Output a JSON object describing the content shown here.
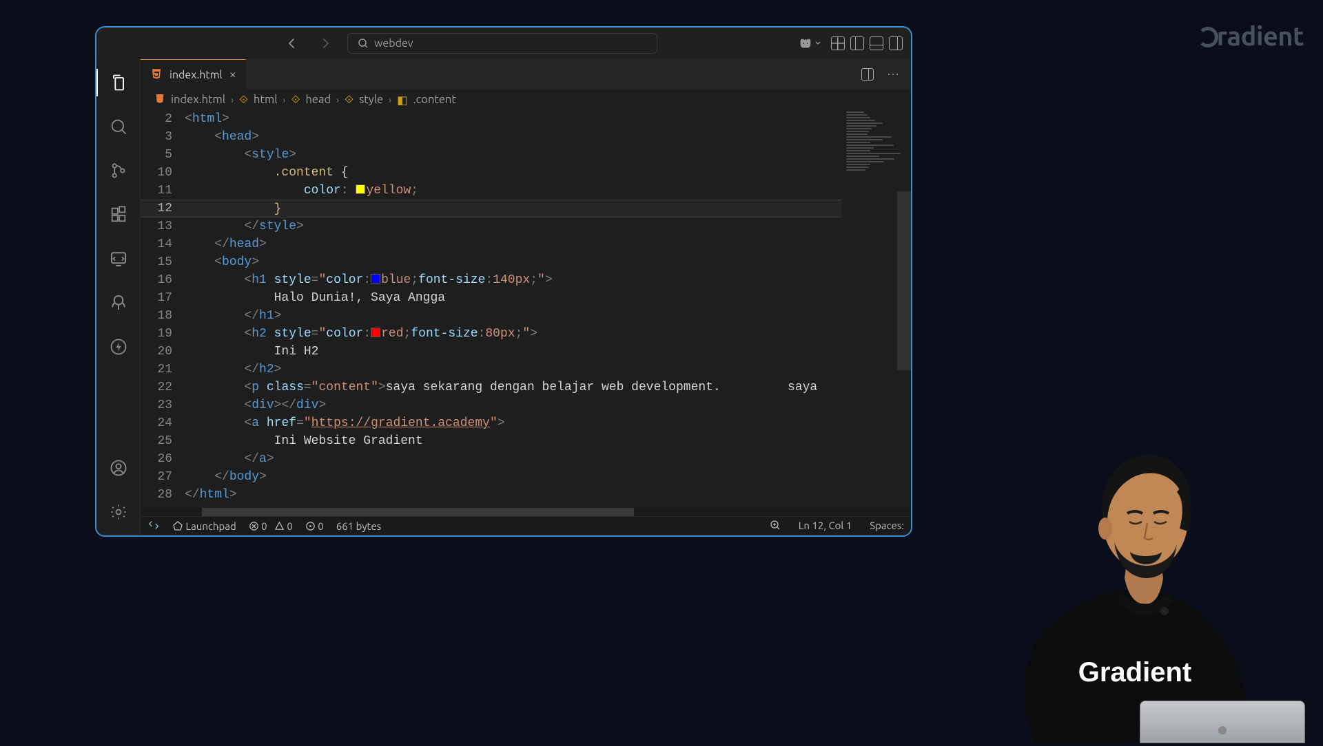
{
  "watermark": "radient",
  "titlebar": {
    "search_value": "webdev"
  },
  "tab": {
    "filename": "index.html",
    "file_icon": "html5-icon"
  },
  "breadcrumb": [
    "index.html",
    "html",
    "head",
    "style",
    ".content"
  ],
  "code": {
    "lines": [
      {
        "num": 2,
        "indent": 0,
        "type": "open",
        "tag": "html"
      },
      {
        "num": 3,
        "indent": 1,
        "type": "open",
        "tag": "head"
      },
      {
        "num": 5,
        "indent": 2,
        "type": "open",
        "tag": "style"
      },
      {
        "num": 10,
        "indent": 3,
        "type": "css_sel",
        "sel": ".content",
        "after": " {"
      },
      {
        "num": 11,
        "indent": 4,
        "type": "css_prop",
        "prop": "color",
        "swatch": "yellow",
        "val": "yellow",
        "suffix": ";"
      },
      {
        "num": 12,
        "indent": 3,
        "type": "raw",
        "text": "}",
        "current": true
      },
      {
        "num": 13,
        "indent": 2,
        "type": "close",
        "tag": "style"
      },
      {
        "num": 14,
        "indent": 1,
        "type": "close",
        "tag": "head"
      },
      {
        "num": 15,
        "indent": 1,
        "type": "open",
        "tag": "body"
      },
      {
        "num": 16,
        "indent": 2,
        "type": "open",
        "tag": "h1",
        "attr": "style",
        "inline_css": [
          {
            "prop": "color",
            "swatch": "blue",
            "val": "blue"
          },
          {
            "prop": "font-size",
            "val": "140px"
          }
        ]
      },
      {
        "num": 17,
        "indent": 3,
        "type": "text",
        "text": "Halo Dunia!, Saya Angga"
      },
      {
        "num": 18,
        "indent": 2,
        "type": "close",
        "tag": "h1"
      },
      {
        "num": 19,
        "indent": 2,
        "type": "open",
        "tag": "h2",
        "attr": "style",
        "inline_css": [
          {
            "prop": "color",
            "swatch": "red",
            "val": "red"
          },
          {
            "prop": "font-size",
            "val": "80px"
          }
        ]
      },
      {
        "num": 20,
        "indent": 3,
        "type": "text",
        "text": "Ini H2"
      },
      {
        "num": 21,
        "indent": 2,
        "type": "close",
        "tag": "h2"
      },
      {
        "num": 22,
        "indent": 2,
        "type": "open_text",
        "tag": "p",
        "attr": "class",
        "attr_val": "content",
        "inner": "saya sekarang dengan belajar web development.",
        "tail": "         saya"
      },
      {
        "num": 23,
        "indent": 2,
        "type": "open_close",
        "tag": "div"
      },
      {
        "num": 24,
        "indent": 2,
        "type": "open",
        "tag": "a",
        "attr": "href",
        "attr_val_url": "https://gradient.academy"
      },
      {
        "num": 25,
        "indent": 3,
        "type": "text",
        "text": "Ini Website Gradient"
      },
      {
        "num": 26,
        "indent": 2,
        "type": "close",
        "tag": "a"
      },
      {
        "num": 27,
        "indent": 1,
        "type": "close",
        "tag": "body"
      },
      {
        "num": 28,
        "indent": 0,
        "type": "close",
        "tag": "html"
      }
    ]
  },
  "statusbar": {
    "launchpad": "Launchpad",
    "errors": "0",
    "warnings": "0",
    "hints": "0",
    "bytes": "661 bytes",
    "cursor": "Ln 12, Col 1",
    "spaces": "Spaces:"
  },
  "presenter_tshirt": "Gradient"
}
